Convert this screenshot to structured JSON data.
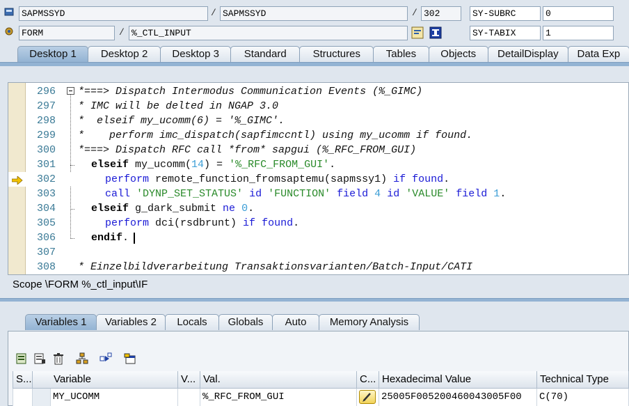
{
  "header": {
    "program1": "SAPMSSYD",
    "program2": "SAPMSSYD",
    "line_no": "302",
    "type_label": "FORM",
    "routine": "%_CTL_INPUT",
    "sysfield1_name": "SY-SUBRC",
    "sysfield1_value": "0",
    "sysfield2_name": "SY-TABIX",
    "sysfield2_value": "1",
    "slash": "/"
  },
  "top_tabs": [
    "Desktop 1",
    "Desktop 2",
    "Desktop 3",
    "Standard",
    "Structures",
    "Tables",
    "Objects",
    "DetailDisplay",
    "Data Exp"
  ],
  "code": {
    "lines": [
      {
        "n": "296",
        "t": "*===> Dispatch Intermodus Communication Events (%_GIMC)"
      },
      {
        "n": "297",
        "t": "* IMC will be delted in NGAP 3.0"
      },
      {
        "n": "298",
        "t": "*  elseif my_ucomm(6) = '%_GIMC'."
      },
      {
        "n": "299",
        "t": "*    perform imc_dispatch(sapfimccntl) using my_ucomm if found."
      },
      {
        "n": "300",
        "t": "*===> Dispatch RFC call *from* sapgui (%_RFC_FROM_GUI)"
      },
      {
        "n": "301",
        "t": "elseif my_ucomm(14) = '%_RFC_FROM_GUI'."
      },
      {
        "n": "302",
        "t": "perform remote_function_fromsaptemu(sapmssy1) if found."
      },
      {
        "n": "303",
        "t": "call 'DYNP_SET_STATUS' id 'FUNCTION' field 4 id 'VALUE' field 1."
      },
      {
        "n": "304",
        "t": "elseif g_dark_submit ne 0."
      },
      {
        "n": "305",
        "t": "perform dci(rsdbrunt) if found."
      },
      {
        "n": "306",
        "t": "endif."
      },
      {
        "n": "307",
        "t": ""
      },
      {
        "n": "308",
        "t": "* Einzelbildverarbeitung Transaktionsvarianten/Batch-Input/CATI"
      }
    ],
    "current_line": "302"
  },
  "scope": "Scope \\FORM %_ctl_input\\IF",
  "bottom_tabs": [
    "Variables 1",
    "Variables 2",
    "Locals",
    "Globals",
    "Auto",
    "Memory Analysis"
  ],
  "grid": {
    "headers": [
      "S...",
      "Variable",
      "V...",
      "Val.",
      "C...",
      "Hexadecimal Value",
      "Technical Type"
    ],
    "row": {
      "variable": "MY_UCOMM",
      "value": "%_RFC_FROM_GUI",
      "hex": "25005F005200460043005F00",
      "type": "C(70)"
    }
  },
  "colors": {
    "accent": "#93b3d3",
    "gutter": "#f1e9cf",
    "keyword": "#1a1ad6",
    "string": "#2a8a2a",
    "comment": "#6b7b9a",
    "arrow": "#e6b800"
  }
}
